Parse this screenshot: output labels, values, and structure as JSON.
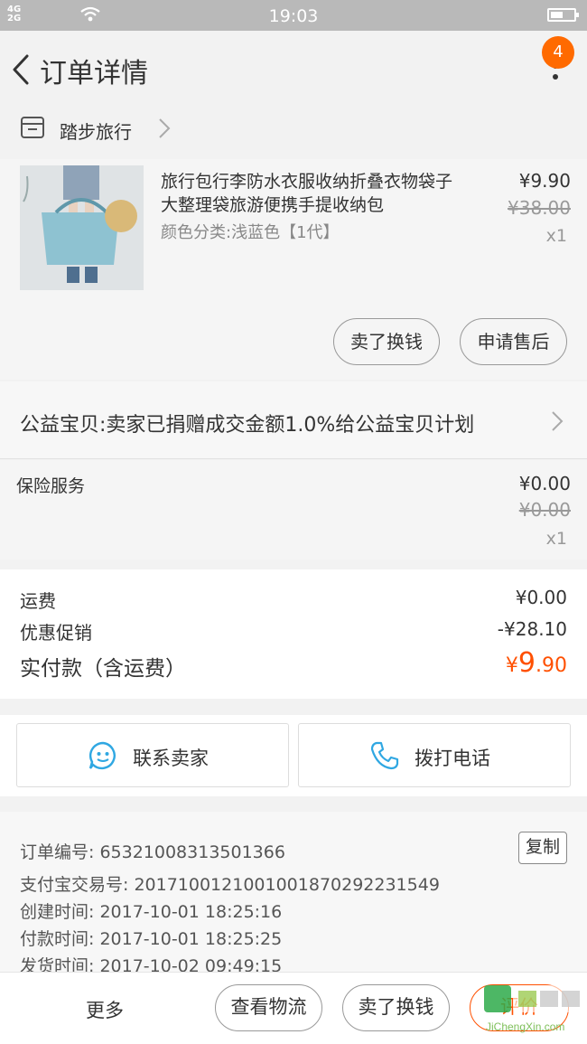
{
  "status": {
    "network_left": "4G",
    "network_right": "2G",
    "time": "19:03"
  },
  "nav": {
    "title": "订单详情",
    "badge": "4"
  },
  "shop": {
    "name": "踏步旅行"
  },
  "product": {
    "title": "旅行包行李防水衣服收纳折叠衣物袋子大整理袋旅游便携手提收纳包",
    "variant": "颜色分类:浅蓝色【1代】",
    "price": "¥9.90",
    "original_price": "¥38.00",
    "qty": "x1",
    "btn_sell": "卖了换钱",
    "btn_after": "申请售后"
  },
  "charity": {
    "text": "公益宝贝:卖家已捐赠成交金额1.0%给公益宝贝计划"
  },
  "insurance": {
    "label": "保险服务",
    "price": "¥0.00",
    "original_price": "¥0.00",
    "qty": "x1"
  },
  "summary": {
    "shipping_label": "运费",
    "shipping_value": "¥0.00",
    "discount_label": "优惠促销",
    "discount_value": "-¥28.10",
    "paid_label": "实付款（含运费）",
    "paid_currency": "¥",
    "paid_int": "9",
    "paid_dec": ".90"
  },
  "contact": {
    "seller": "联系卖家",
    "call": "拨打电话"
  },
  "order_info": {
    "order_no": "订单编号: 65321008313501366",
    "alipay_no": "支付宝交易号: 2017100121001001870292231549",
    "created": "创建时间: 2017-10-01 18:25:16",
    "paid": "付款时间: 2017-10-01 18:25:25",
    "shipped": "发货时间: 2017-10-02 09:49:15",
    "copy": "复制"
  },
  "bottom": {
    "more": "更多",
    "logistics": "查看物流",
    "sell": "卖了换钱",
    "rate": "评价"
  },
  "watermark": {
    "text": "JiChengXin.com"
  },
  "colors": {
    "accent": "#ff5000",
    "badge": "#ff6a00",
    "status_bar": "#b9b9b9",
    "icon_blue": "#2fa7e2"
  }
}
